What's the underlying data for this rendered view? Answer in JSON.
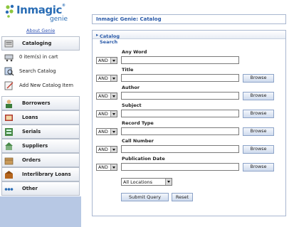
{
  "app": {
    "logo_text": "Inmagic",
    "logo_registered": "®",
    "logo_sub": "genie",
    "about_link": "About Genie"
  },
  "sidebar": {
    "cataloging": "Cataloging",
    "cart": "0 item(s) in cart",
    "search_catalog": "Search Catalog",
    "add_item": "Add New Catalog Item",
    "items": [
      {
        "label": "Borrowers",
        "icon": "borrowers-icon"
      },
      {
        "label": "Loans",
        "icon": "loans-icon"
      },
      {
        "label": "Serials",
        "icon": "serials-icon"
      },
      {
        "label": "Suppliers",
        "icon": "suppliers-icon"
      },
      {
        "label": "Orders",
        "icon": "orders-icon"
      },
      {
        "label": "Interlibrary Loans",
        "icon": "interlibrary-loans-icon"
      },
      {
        "label": "Other",
        "icon": "other-icon"
      }
    ]
  },
  "main": {
    "title": "Inmagic Genie: Catalog",
    "panel_title": "Catalog Search",
    "fields": [
      {
        "label": "Any Word",
        "operator": "AND",
        "value": "",
        "browse": ""
      },
      {
        "label": "Title",
        "operator": "AND",
        "value": "",
        "browse": "Browse"
      },
      {
        "label": "Author",
        "operator": "AND",
        "value": "",
        "browse": "Browse"
      },
      {
        "label": "Subject",
        "operator": "AND",
        "value": "",
        "browse": "Browse"
      },
      {
        "label": "Record Type",
        "operator": "AND",
        "value": "",
        "browse": "Browse"
      },
      {
        "label": "Call Number",
        "operator": "AND",
        "value": "",
        "browse": "Browse"
      },
      {
        "label": "Publication Date",
        "operator": "AND",
        "value": "",
        "browse": "Browse"
      }
    ],
    "location": "All Locations",
    "submit": "Submit Query",
    "reset": "Reset"
  },
  "colors": {
    "brand_blue": "#2a6db5",
    "title_blue": "#2a5aa8",
    "sidebar_footer": "#b7c8e4"
  }
}
